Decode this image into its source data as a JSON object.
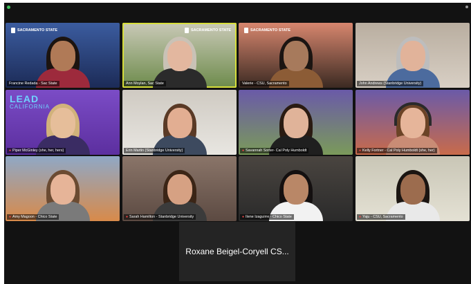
{
  "app": {
    "status_color": "#3ec25a"
  },
  "participants": [
    {
      "name": "Francine Redada - Sac State",
      "logo": "SACRAMENTO STATE",
      "bg": "#1c2b57",
      "bg2": "#3b5c9f",
      "skin": "#b07a57",
      "hair": "#1c1410",
      "top": "#9d2a3c",
      "mic_muted": false
    },
    {
      "name": "Ann Moylan, Sac State",
      "logo": "SACRAMENTO STATE",
      "bg": "#6d8b4b",
      "bg2": "#c9c9b7",
      "skin": "#e3b79f",
      "hair": "#c9c2b6",
      "top": "#2b2b2b",
      "mic_muted": false,
      "active_speaker": true
    },
    {
      "name": "Valerie - CSU, Sacramento",
      "logo": "SACRAMENTO STATE",
      "bg": "#3b2a22",
      "bg2": "#d7866e",
      "skin": "#a77a5c",
      "hair": "#1b1512",
      "top": "#8c5c36",
      "mic_muted": false
    },
    {
      "name": "John Andrews (Stanbridge University)",
      "logo": "",
      "bg": "#d8cfc4",
      "bg2": "#b9aea0",
      "skin": "#e1b39a",
      "hair": "#bdbdbd",
      "top": "#4c6b9e",
      "mic_muted": false
    },
    {
      "name": "Piper McGinley (she, her, hers)",
      "logo": "LEAD CALIFORNIA",
      "bg": "#5c2f9f",
      "bg2": "#7b4cc6",
      "skin": "#e6be9a",
      "hair": "#d1b27b",
      "top": "#3a2c63",
      "mic_muted": true
    },
    {
      "name": "Erin Martin (Stanbridge University)",
      "logo": "",
      "bg": "#e8e6e1",
      "bg2": "#cfcac2",
      "skin": "#e2ae92",
      "hair": "#5a3a26",
      "top": "#3d4a5f",
      "mic_muted": false
    },
    {
      "name": "Savannah Sorter- Cal Poly Humboldt",
      "logo": "",
      "bg": "#7a9a5a",
      "bg2": "#6a5aa8",
      "skin": "#e0b399",
      "hair": "#2a1b12",
      "top": "#1f1f1f",
      "mic_muted": true
    },
    {
      "name": "Kelly Fortner - Cal Poly Humboldt (she, her)",
      "logo": "",
      "bg": "#c86b4b",
      "bg2": "#6a5aa8",
      "skin": "#e6b59a",
      "hair": "#6b4326",
      "top": "#c98c75",
      "mic_muted": true,
      "headphones": true
    },
    {
      "name": "Amy Magoon - Chico State",
      "logo": "",
      "bg": "#d88a4a",
      "bg2": "#8fa8c6",
      "skin": "#e6b498",
      "hair": "#6b4b32",
      "top": "#7a7a7a",
      "mic_muted": true
    },
    {
      "name": "Sarah Hamilton - Stanbridge University",
      "logo": "",
      "bg": "#5c4a42",
      "bg2": "#8a7569",
      "skin": "#d6a183",
      "hair": "#3b2516",
      "top": "#3b3b3b",
      "mic_muted": true
    },
    {
      "name": "Ilene Izaguirre - Chico State",
      "logo": "",
      "bg": "#2a2a2a",
      "bg2": "#4a4540",
      "skin": "#b98767",
      "hair": "#141010",
      "top": "#f2f2f2",
      "mic_muted": true
    },
    {
      "name": "Yaju - CSU, Sacramento",
      "logo": "",
      "bg": "#e4e1d4",
      "bg2": "#c9c6b6",
      "skin": "#9c6c4e",
      "hair": "#1b1512",
      "top": "#e9e9e9",
      "mic_muted": true
    }
  ],
  "bottom_tile": {
    "label": "Roxane Beigel-Coryell   CS..."
  }
}
